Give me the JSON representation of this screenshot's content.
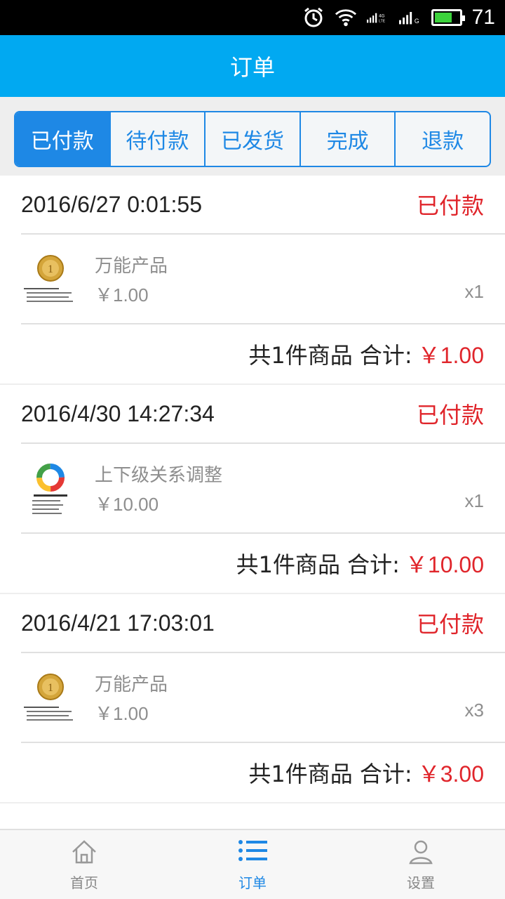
{
  "status_bar": {
    "battery": "71",
    "network": "4G",
    "network_sub": "LTE"
  },
  "appbar": {
    "title": "订单"
  },
  "tabs": [
    {
      "label": "已付款",
      "active": true
    },
    {
      "label": "待付款",
      "active": false
    },
    {
      "label": "已发货",
      "active": false
    },
    {
      "label": "完成",
      "active": false
    },
    {
      "label": "退款",
      "active": false
    }
  ],
  "orders": [
    {
      "date": "2016/6/27 0:01:55",
      "status": "已付款",
      "item": {
        "name": "万能产品",
        "price": "￥1.00",
        "qty": "x1",
        "icon": "gold-coin-icon"
      },
      "summary": "共1件商品 合计:",
      "total": "￥1.00"
    },
    {
      "date": "2016/4/30 14:27:34",
      "status": "已付款",
      "item": {
        "name": "上下级关系调整",
        "price": "￥10.00",
        "qty": "x1",
        "icon": "colorful-ring-icon"
      },
      "summary": "共1件商品 合计:",
      "total": "￥10.00"
    },
    {
      "date": "2016/4/21 17:03:01",
      "status": "已付款",
      "item": {
        "name": "万能产品",
        "price": "￥1.00",
        "qty": "x3",
        "icon": "gold-coin-icon"
      },
      "summary": "共1件商品 合计:",
      "total": "￥3.00"
    }
  ],
  "bottom_nav": [
    {
      "label": "首页",
      "icon": "home-icon",
      "active": false
    },
    {
      "label": "订单",
      "icon": "list-icon",
      "active": true
    },
    {
      "label": "设置",
      "icon": "user-icon",
      "active": false
    }
  ],
  "colors": {
    "primary": "#01a9f1",
    "tab_blue": "#1e88e5",
    "status_red": "#e0252b"
  }
}
